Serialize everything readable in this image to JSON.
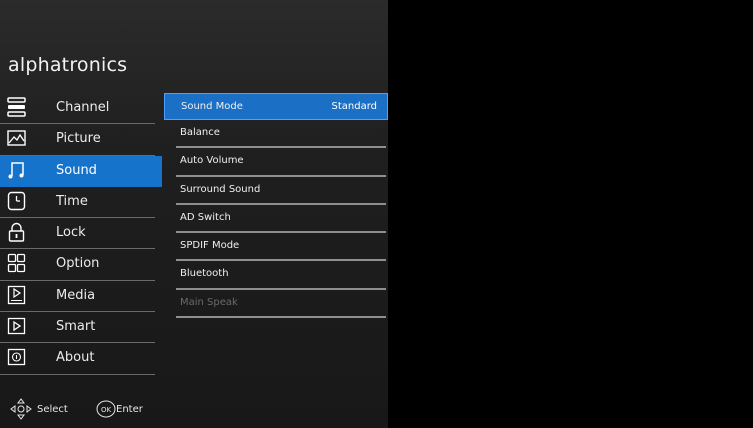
{
  "brand": "alphatronics",
  "nav": {
    "items": [
      {
        "label": "Channel",
        "icon": "list-icon",
        "active": false
      },
      {
        "label": "Picture",
        "icon": "picture-icon",
        "active": false
      },
      {
        "label": "Sound",
        "icon": "music-note-icon",
        "active": true
      },
      {
        "label": "Time",
        "icon": "clock-icon",
        "active": false
      },
      {
        "label": "Lock",
        "icon": "lock-icon",
        "active": false
      },
      {
        "label": "Option",
        "icon": "grid-icon",
        "active": false
      },
      {
        "label": "Media",
        "icon": "media-icon",
        "active": false
      },
      {
        "label": "Smart",
        "icon": "play-icon",
        "active": false
      },
      {
        "label": "About",
        "icon": "info-icon",
        "active": false
      }
    ]
  },
  "submenu": {
    "items": [
      {
        "label": "Sound Mode",
        "value": "Standard",
        "active": true
      },
      {
        "label": "Balance"
      },
      {
        "label": "Auto Volume"
      },
      {
        "label": "Surround Sound"
      },
      {
        "label": "AD Switch"
      },
      {
        "label": "SPDIF Mode"
      },
      {
        "label": "Bluetooth"
      },
      {
        "label": "Main Speak",
        "disabled": true
      }
    ]
  },
  "hints": {
    "select_label": "Select",
    "ok_icon_text": "OK",
    "enter_label": "Enter"
  },
  "colors": {
    "accent": "#1673cc",
    "panel_bg": "#1f1f1f",
    "screen_bg": "#000000",
    "disabled_text": "#6a6a6a"
  }
}
